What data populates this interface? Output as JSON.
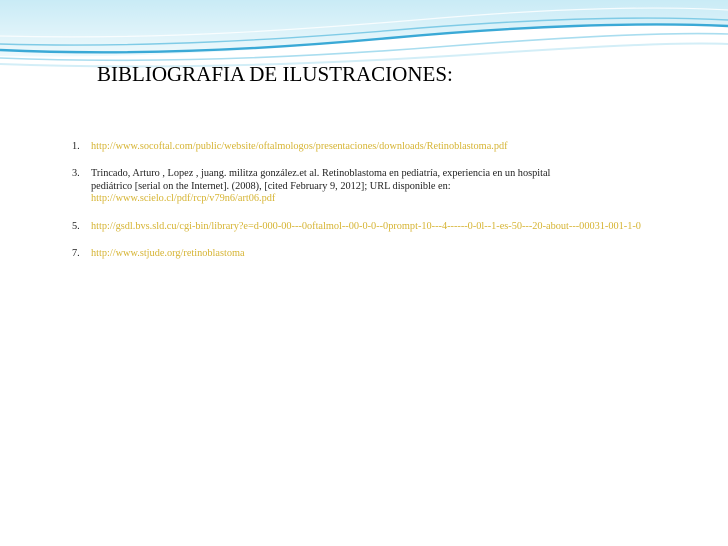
{
  "slide": {
    "title": "BIBLIOGRAFIA DE ILUSTRACIONES:",
    "colors": {
      "link": "#d6b433",
      "text": "#222222",
      "wave_dark": "#3aa9d6",
      "wave_light": "#bfe6f3"
    },
    "references": [
      {
        "number": "1.",
        "lines": [],
        "link": "http://www.socoftal.com/public/website/oftalmologos/presentaciones/downloads/Retinoblastoma.pdf"
      },
      {
        "number": "3.",
        "lines": [
          " Trincado, Arturo , Lopez , juang. militza gonzález.et al. Retinoblastoma en pediatría, experiencia en un hospital",
          "pediátrico [serial on the Internet]. (2008), [cited February 9, 2012]; URL disponible en:"
        ],
        "link": "http://www.scielo.cl/pdf/rcp/v79n6/art06.pdf"
      },
      {
        "number": "5.",
        "lines": [],
        "link": "http://gsdl.bvs.sld.cu/cgi-bin/library?e=d-000-00---0oftalmol--00-0-0--0prompt-10---4------0-0l--1-es-50---20-about---00031-001-1-0"
      },
      {
        "number": "7.",
        "lines": [],
        "link": "http://www.stjude.org/retinoblastoma"
      }
    ]
  }
}
